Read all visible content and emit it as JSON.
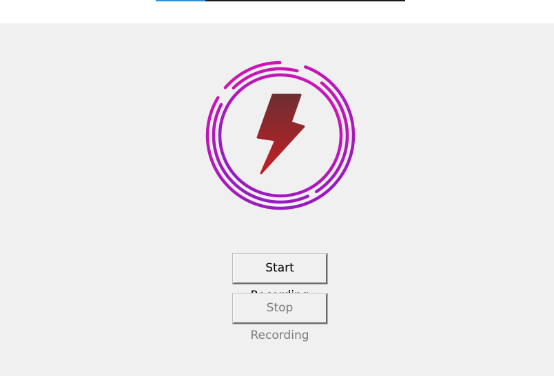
{
  "progress": {
    "fraction": 0.2,
    "fill_color": "#2f8fd8",
    "track_color": "#1a1a1a"
  },
  "logo": {
    "icon": "lightning-bolt-in-rings-icon",
    "ring_gradient": [
      "#8a1dc4",
      "#d814b0"
    ],
    "bolt_gradient": [
      "#6e2e32",
      "#c21f24"
    ]
  },
  "controls": {
    "start_label": "Start Recording",
    "stop_label": "Stop Recording",
    "stop_enabled": false
  }
}
